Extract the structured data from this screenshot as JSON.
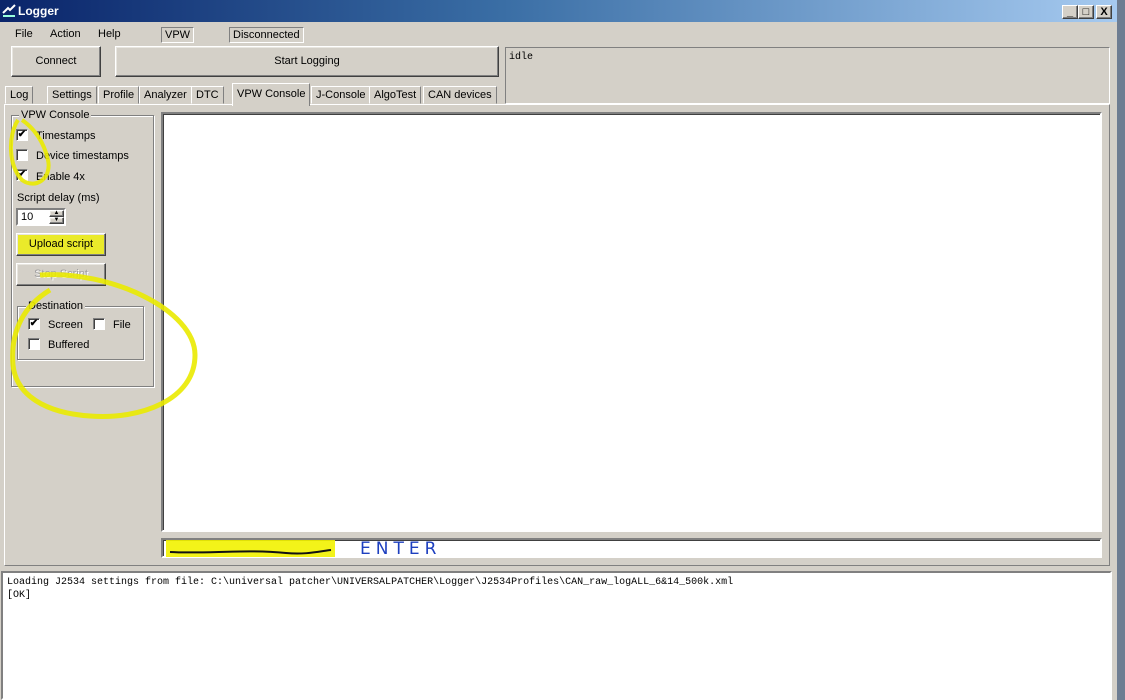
{
  "window": {
    "title": "Logger",
    "controls": [
      "_",
      "□",
      "X"
    ]
  },
  "menu": [
    "File",
    "Action",
    "Help"
  ],
  "status": {
    "protocol": "VPW",
    "connection": "Disconnected"
  },
  "toolbar": {
    "connect": "Connect",
    "start_logging": "Start Logging"
  },
  "status_text": "idle",
  "tabs": [
    "Log",
    "Settings",
    "Profile",
    "Analyzer",
    "DTC",
    "VPW Console",
    "J-Console",
    "AlgoTest",
    "CAN devices"
  ],
  "vpw_console": {
    "group_title": "VPW Console",
    "options": [
      {
        "label": "Timestamps",
        "checked": true
      },
      {
        "label": "Device timestamps",
        "checked": false
      },
      {
        "label": "Enable 4x",
        "checked": true
      }
    ],
    "script_delay_label": "Script delay (ms)",
    "script_delay_value": "10",
    "upload_script": "Upload script",
    "stop_script": "Stop Script",
    "destination": {
      "title": "Destination",
      "screen": {
        "label": "Screen",
        "checked": true
      },
      "file": {
        "label": "File",
        "checked": false
      },
      "buffered": {
        "label": "Buffered",
        "checked": false
      }
    }
  },
  "command_input": {
    "value": "",
    "annotation": "ENTER"
  },
  "log_output": [
    "Loading J2534 settings from file: C:\\universal patcher\\UNIVERSALPATCHER\\Logger\\J2534Profiles\\CAN_raw_logALL_6&14_500k.xml",
    "[OK]"
  ],
  "colors": {
    "titlebar_start": "#0a246a",
    "titlebar_end": "#a6caf0",
    "highlight": "#f2f200",
    "annotation_ink": "#1d3fbf"
  }
}
